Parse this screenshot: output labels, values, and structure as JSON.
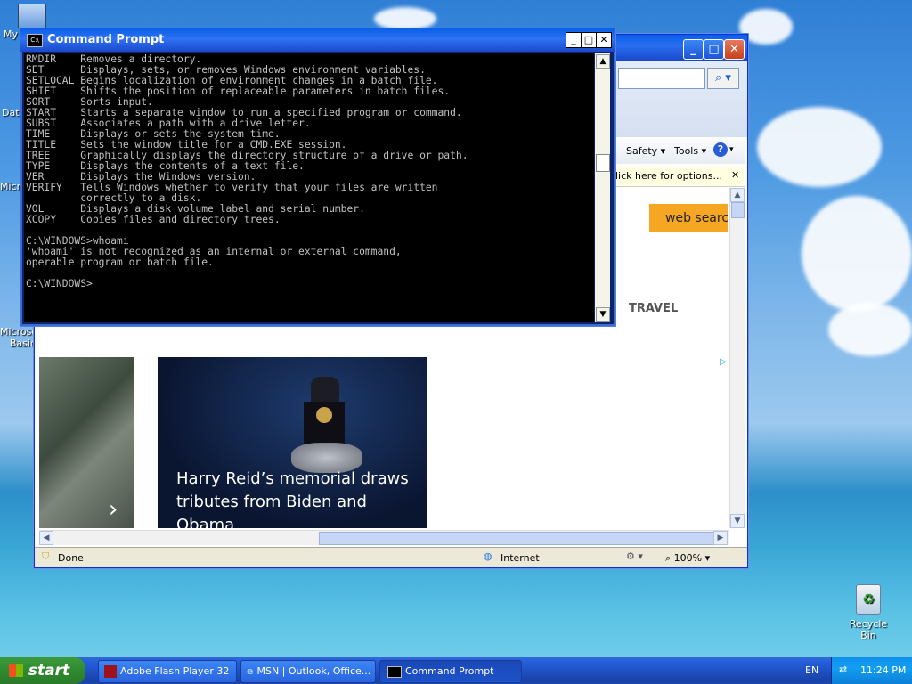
{
  "desktop": {
    "icons": [
      {
        "label": "My",
        "name": "my-computer-icon"
      },
      {
        "label": "Dat",
        "name": "data-icon"
      },
      {
        "label": "Microsc",
        "name": "microsoft-icon"
      },
      {
        "label": "Microsof Basic",
        "name": "microsoft-basic-icon"
      },
      {
        "label": "Recycle Bin",
        "name": "recycle-bin-icon"
      }
    ]
  },
  "cmd": {
    "title": "Command Prompt",
    "lines": [
      "RMDIR    Removes a directory.",
      "SET      Displays, sets, or removes Windows environment variables.",
      "SETLOCAL Begins localization of environment changes in a batch file.",
      "SHIFT    Shifts the position of replaceable parameters in batch files.",
      "SORT     Sorts input.",
      "START    Starts a separate window to run a specified program or command.",
      "SUBST    Associates a path with a drive letter.",
      "TIME     Displays or sets the system time.",
      "TITLE    Sets the window title for a CMD.EXE session.",
      "TREE     Graphically displays the directory structure of a drive or path.",
      "TYPE     Displays the contents of a text file.",
      "VER      Displays the Windows version.",
      "VERIFY   Tells Windows whether to verify that your files are written",
      "         correctly to a disk.",
      "VOL      Displays a disk volume label and serial number.",
      "XCOPY    Copies files and directory trees.",
      "",
      "C:\\WINDOWS>whoami",
      "'whoami' is not recognized as an internal or external command,",
      "operable program or batch file.",
      "",
      "C:\\WINDOWS>"
    ]
  },
  "ie": {
    "toolbar": {
      "safety": "Safety",
      "tools": "Tools",
      "help_icon": "help-icon"
    },
    "infobar": "lick here for options...",
    "search_label": "web search",
    "category": "TRAVEL",
    "headline": "Harry Reid’s memorial draws tributes from Biden and Obama",
    "status": {
      "done": "Done",
      "zone": "Internet",
      "zoom": "100%"
    }
  },
  "taskbar": {
    "start": "start",
    "tasks": [
      "Adobe Flash Player 32",
      "MSN | Outlook, Office...",
      "Command Prompt"
    ],
    "lang": "EN",
    "clock": "11:24 PM"
  },
  "colors": {
    "xp_blue": "#245edb",
    "start_green": "#2f8a2f",
    "search_orange": "#f5a623"
  }
}
